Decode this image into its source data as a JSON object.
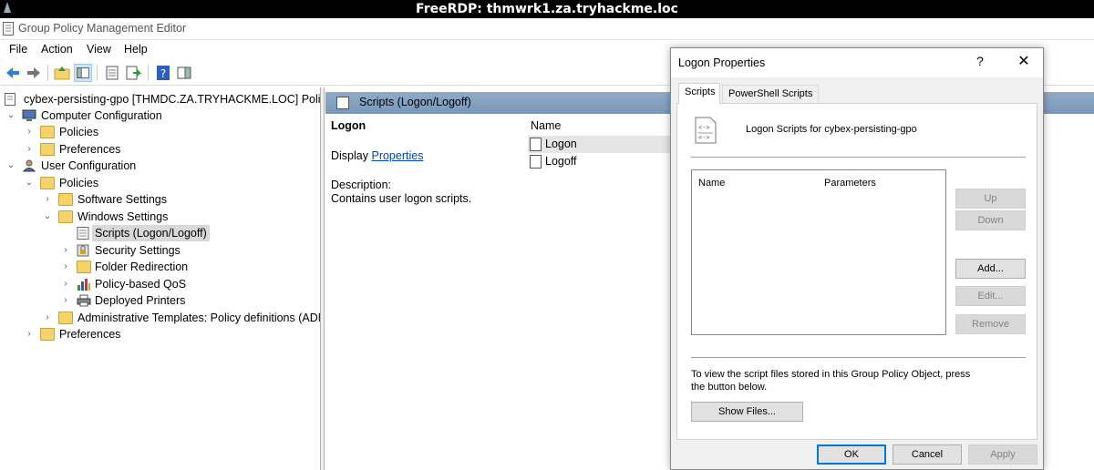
{
  "rdp": {
    "title": "FreeRDP: thmwrk1.za.tryhackme.loc"
  },
  "app": {
    "title": "Group Policy Management Editor"
  },
  "menu": [
    "File",
    "Action",
    "View",
    "Help"
  ],
  "tree": {
    "root": "cybex-persisting-gpo [THMDC.ZA.TRYHACKME.LOC] Policy",
    "computer_config": "Computer Configuration",
    "cc_policies": "Policies",
    "cc_preferences": "Preferences",
    "user_config": "User Configuration",
    "uc_policies": "Policies",
    "software_settings": "Software Settings",
    "windows_settings": "Windows Settings",
    "scripts": "Scripts (Logon/Logoff)",
    "security_settings": "Security Settings",
    "folder_redirection": "Folder Redirection",
    "policy_qos": "Policy-based QoS",
    "deployed_printers": "Deployed Printers",
    "admin_templates": "Administrative Templates: Policy definitions (ADMX",
    "uc_preferences": "Preferences"
  },
  "content": {
    "header": "Scripts (Logon/Logoff)",
    "title": "Logon",
    "display_prefix": "Display",
    "display_link": "Properties",
    "description_label": "Description:",
    "description": "Contains user logon scripts.",
    "list_header": "Name",
    "items": [
      "Logon",
      "Logoff"
    ]
  },
  "dialog": {
    "title": "Logon Properties",
    "help": "?",
    "close": "✕",
    "tabs": [
      "Scripts",
      "PowerShell Scripts"
    ],
    "heading": "Logon Scripts for cybex-persisting-gpo",
    "col_name": "Name",
    "col_params": "Parameters",
    "buttons": {
      "up": "Up",
      "down": "Down",
      "add": "Add...",
      "edit": "Edit...",
      "remove": "Remove",
      "show_files": "Show Files...",
      "ok": "OK",
      "cancel": "Cancel",
      "apply": "Apply"
    },
    "info": "To view the script files stored in this Group Policy Object, press the button below."
  }
}
